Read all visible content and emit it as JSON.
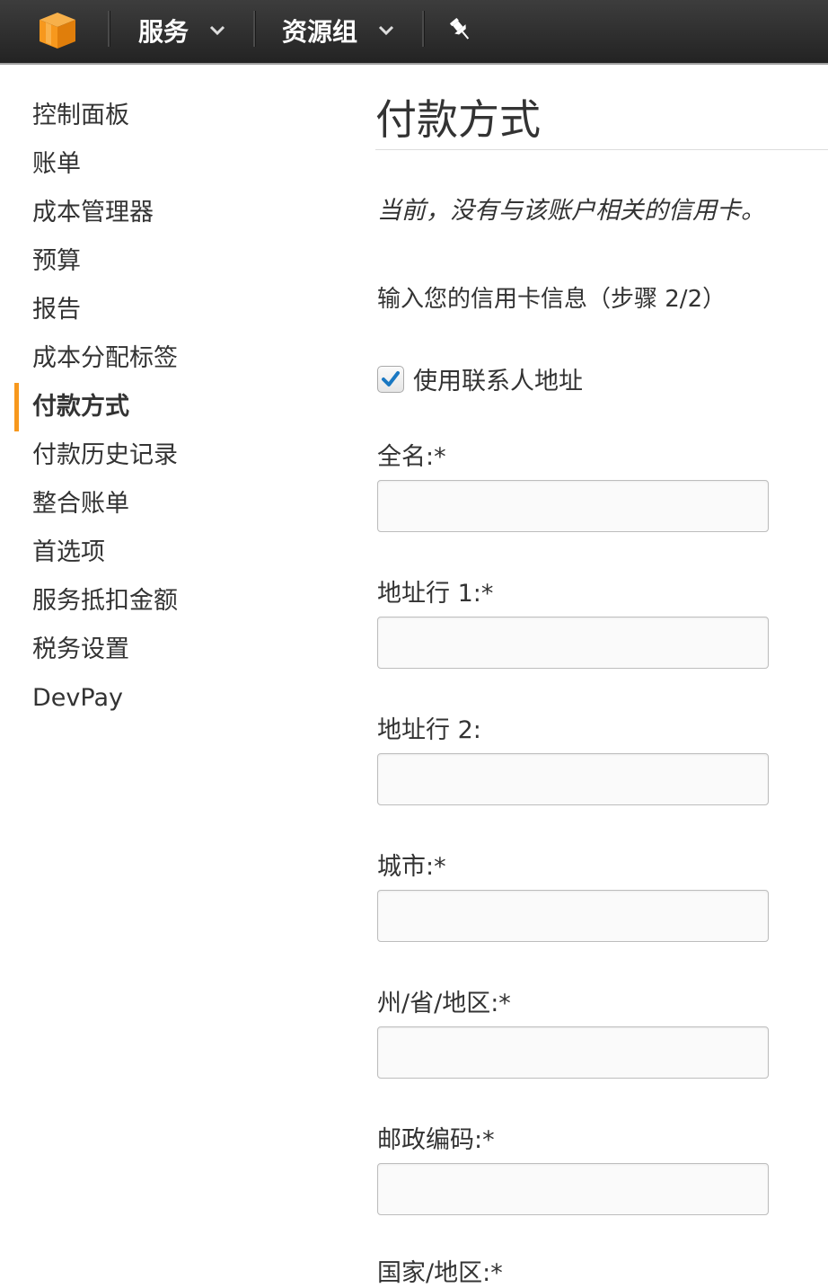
{
  "topbar": {
    "logo_icon": "aws-cube-icon",
    "services_label": "服务",
    "resource_groups_label": "资源组",
    "pin_icon": "pushpin-icon",
    "logo_color": "#f7981d"
  },
  "sidebar": {
    "items": [
      {
        "label": "控制面板"
      },
      {
        "label": "账单"
      },
      {
        "label": "成本管理器"
      },
      {
        "label": "预算"
      },
      {
        "label": "报告"
      },
      {
        "label": "成本分配标签"
      },
      {
        "label": "付款方式",
        "active": true
      },
      {
        "label": "付款历史记录"
      },
      {
        "label": "整合账单"
      },
      {
        "label": "首选项"
      },
      {
        "label": "服务抵扣金额"
      },
      {
        "label": "税务设置"
      },
      {
        "label": "DevPay"
      }
    ],
    "active_color": "#f7981d"
  },
  "main": {
    "title": "付款方式",
    "notice": "当前，没有与该账户相关的信用卡。",
    "step": "输入您的信用卡信息（步骤 2/2）",
    "use_contact_address": {
      "label": "使用联系人地址",
      "checked": true,
      "check_color": "#1a78c2"
    },
    "fields": [
      {
        "label": "全名:*",
        "value": ""
      },
      {
        "label": "地址行 1:*",
        "value": ""
      },
      {
        "label": "地址行 2:",
        "value": ""
      },
      {
        "label": "城市:*",
        "value": ""
      },
      {
        "label": "州/省/地区:*",
        "value": ""
      },
      {
        "label": "邮政编码:*",
        "value": ""
      },
      {
        "label": "国家/地区:*"
      }
    ]
  }
}
